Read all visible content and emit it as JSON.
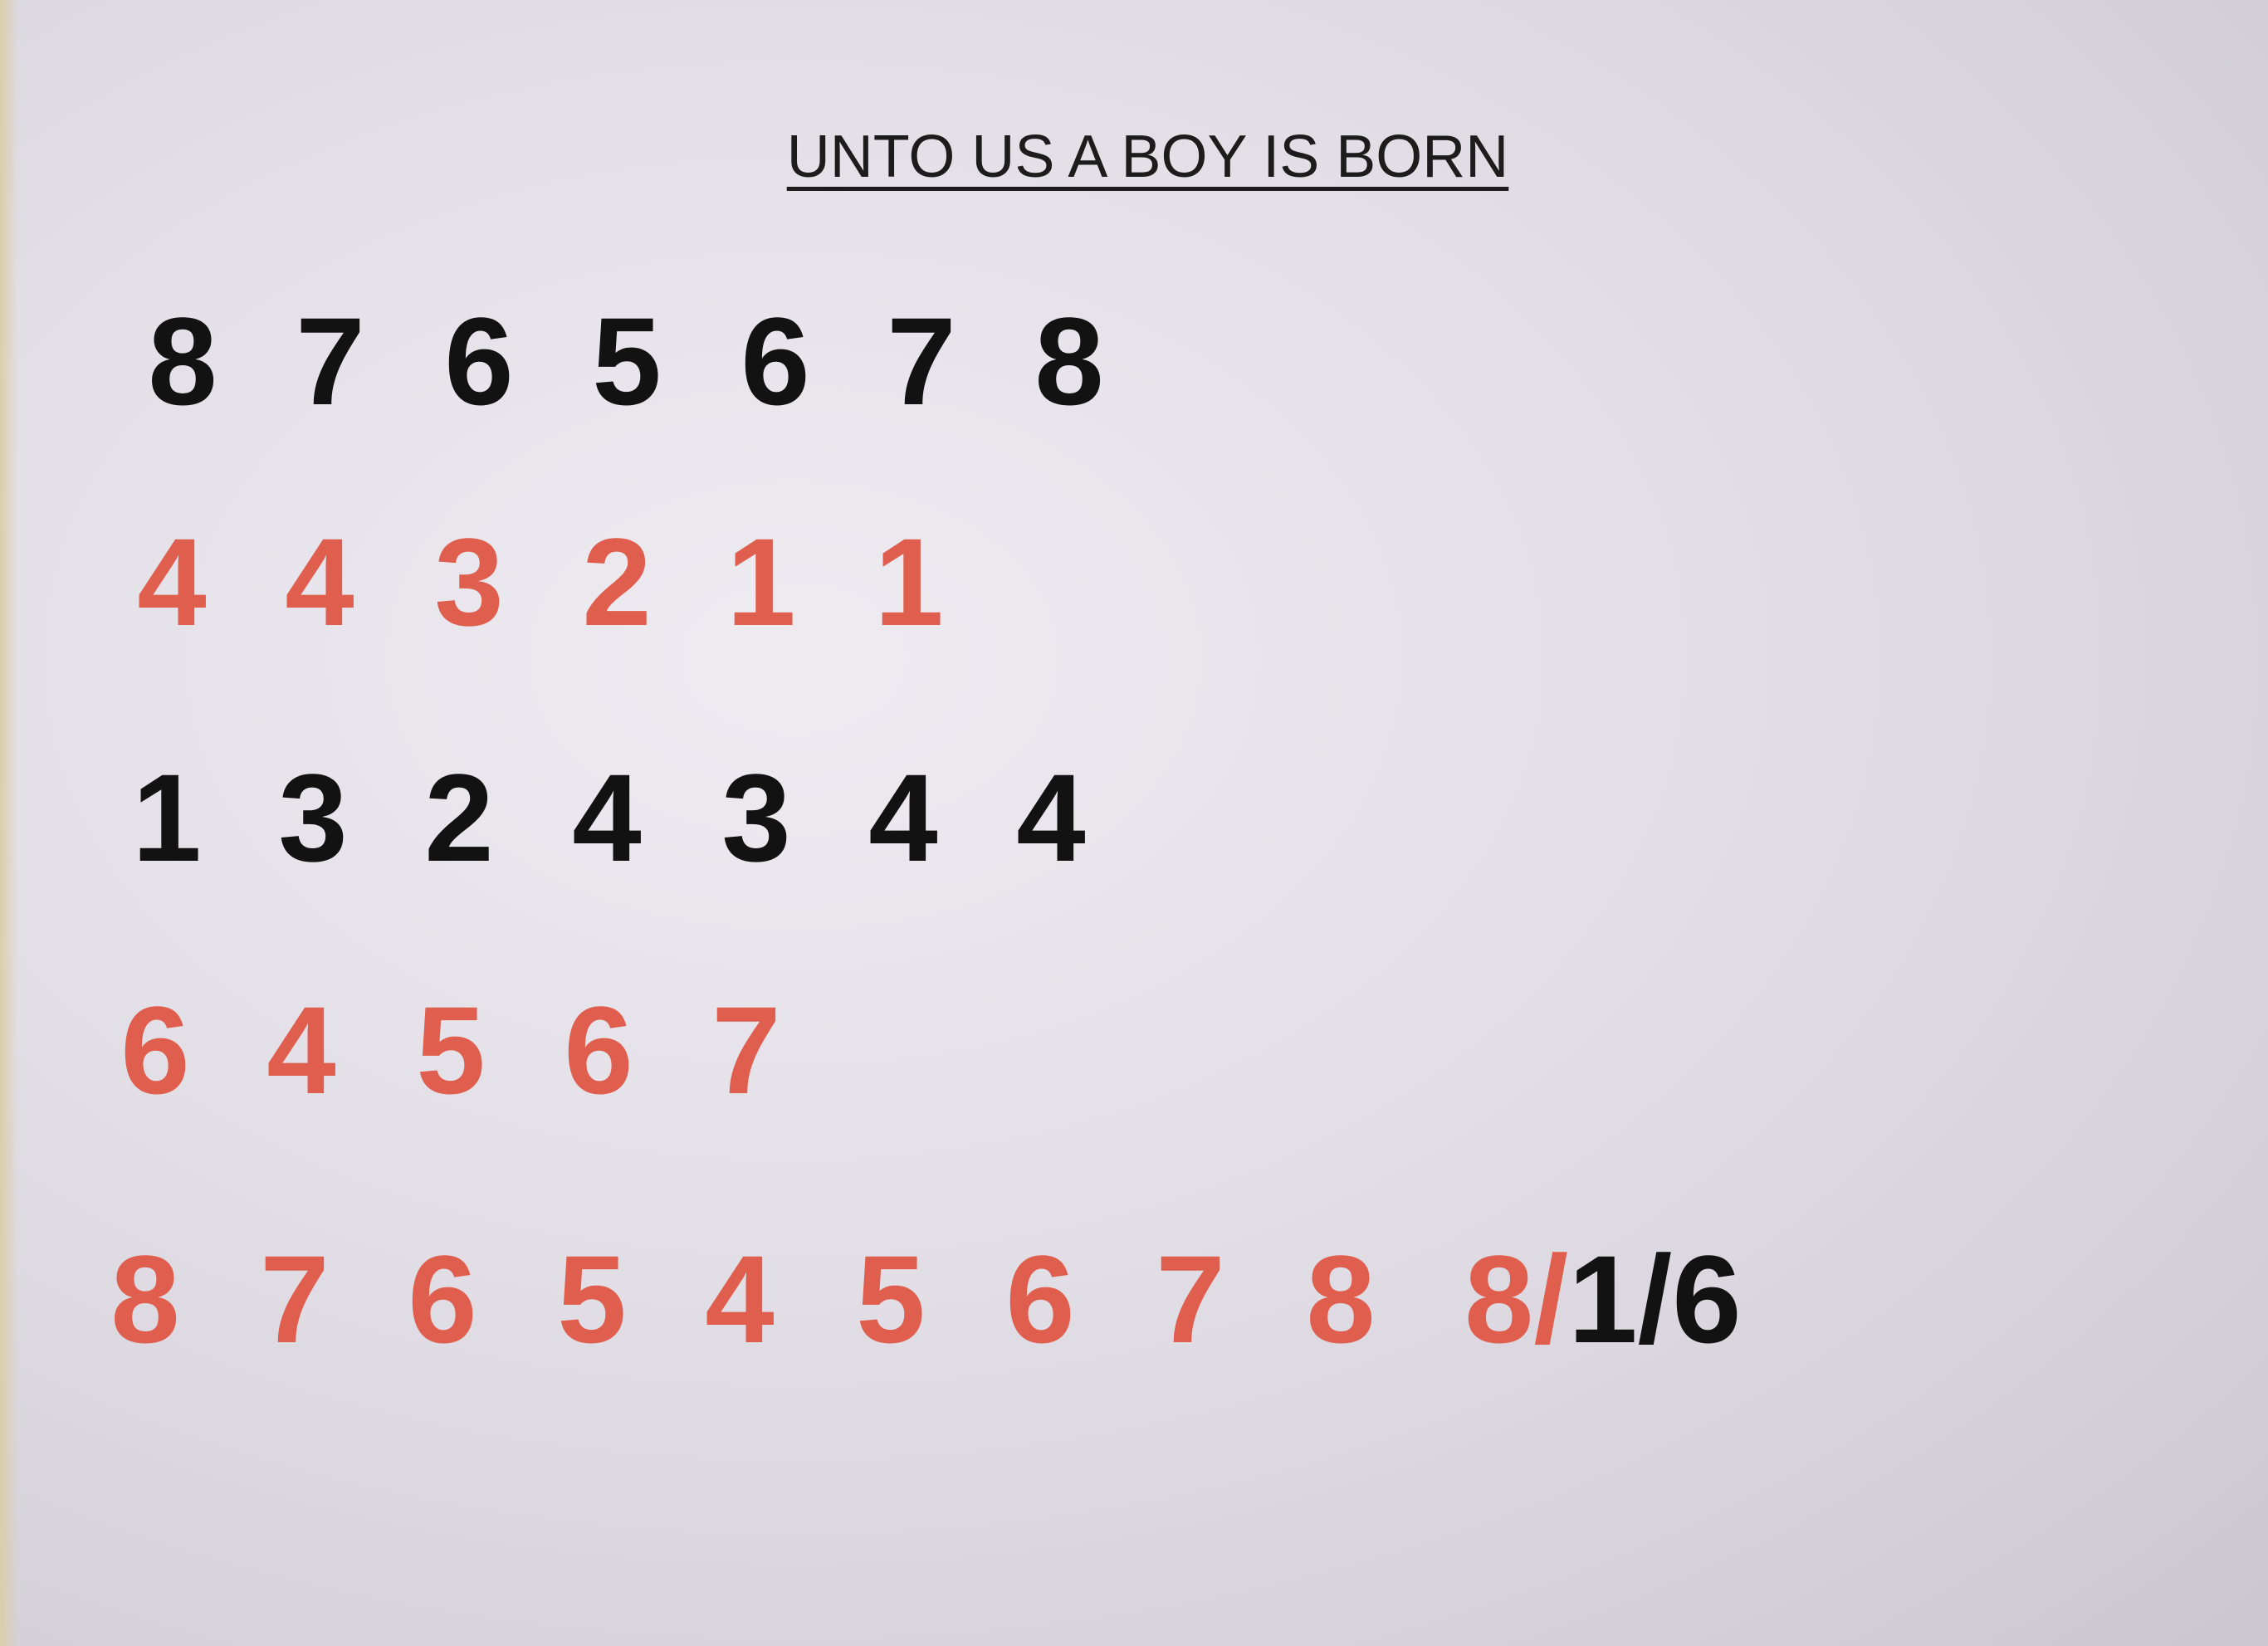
{
  "title": "UNTO US A BOY IS BORN",
  "colors": {
    "red": "#e05e4d",
    "black": "#121212"
  },
  "rows": [
    {
      "color": "black",
      "numbers": [
        "8",
        "7",
        "6",
        "5",
        "6",
        "7",
        "8"
      ]
    },
    {
      "color": "red",
      "numbers": [
        "4",
        "4",
        "3",
        "2",
        "1",
        "1"
      ]
    },
    {
      "color": "black",
      "numbers": [
        "1",
        "3",
        "2",
        "4",
        "3",
        "4",
        "4"
      ]
    },
    {
      "color": "red",
      "numbers": [
        "6",
        "4",
        "5",
        "6",
        "7"
      ]
    },
    {
      "color": "red",
      "numbers": [
        "8",
        "7",
        "6",
        "5",
        "4",
        "5",
        "6",
        "7",
        "8"
      ]
    }
  ],
  "final": {
    "red_part": "8/",
    "black_part": "1/6"
  }
}
